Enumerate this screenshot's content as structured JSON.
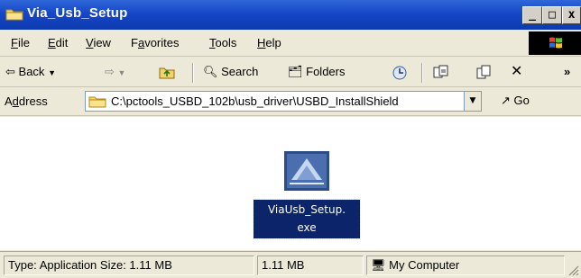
{
  "window": {
    "title": "Via_Usb_Setup",
    "buttons": {
      "minimize": "_",
      "maximize": "□",
      "close": "x"
    }
  },
  "menu": {
    "items": [
      {
        "accel": "F",
        "rest": "ile"
      },
      {
        "accel": "E",
        "rest": "dit"
      },
      {
        "accel": "V",
        "rest": "iew"
      },
      {
        "pre": "F",
        "accel": "a",
        "rest": "vorites"
      },
      {
        "accel": "T",
        "rest": "ools"
      },
      {
        "accel": "H",
        "rest": "elp"
      }
    ]
  },
  "toolbar": {
    "back": "Back",
    "search": "Search",
    "folders": "Folders",
    "overflow": "»"
  },
  "address": {
    "label_pre": "A",
    "label_accel": "d",
    "label_rest": "dress",
    "path": "C:\\pctools_USBD_102b\\usb_driver\\USBD_InstallShield",
    "go": "Go"
  },
  "content": {
    "file_name_line1": "ViaUsb_Setup.",
    "file_name_line2": "exe"
  },
  "status": {
    "info": "Type: Application Size: 1.11 MB",
    "size": "1.11 MB",
    "zone": "My Computer"
  },
  "colors": {
    "title_bar": "#1546c8",
    "selection": "#0b246a",
    "chrome": "#ece9d8"
  }
}
